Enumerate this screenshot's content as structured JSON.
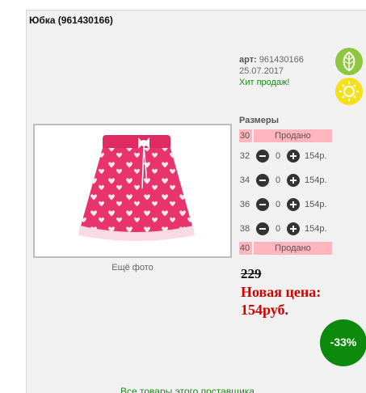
{
  "product": {
    "title": "Юбка (961430166)",
    "art_label": "арт:",
    "art_value": "961430166",
    "date": "25.07.2017",
    "hit": "Хит продаж!"
  },
  "photo": {
    "more_label": "Ещё фото"
  },
  "sizes": {
    "title": "Размеры",
    "rows": [
      {
        "size": "30",
        "status": "Продано"
      },
      {
        "size": "32",
        "qty": "0",
        "price": "154р."
      },
      {
        "size": "34",
        "qty": "0",
        "price": "154р."
      },
      {
        "size": "36",
        "qty": "0",
        "price": "154р."
      },
      {
        "size": "38",
        "qty": "0",
        "price": "154р."
      },
      {
        "size": "40",
        "status": "Продано"
      }
    ]
  },
  "pricing": {
    "old_price": "229",
    "new_price_line1": "Новая цена:",
    "new_price_line2": "154руб.",
    "discount": "-33%"
  },
  "footer": {
    "supplier_link": "Все товары этого поставщика"
  },
  "colors": {
    "sold_bg": "#ffb6be",
    "new_price": "#d40000",
    "discount_bg": "#0b8a0b",
    "hit": "#1a8a1a"
  },
  "icons": {
    "badge_top": "leaf-icon",
    "badge_bottom": "sun-icon"
  }
}
